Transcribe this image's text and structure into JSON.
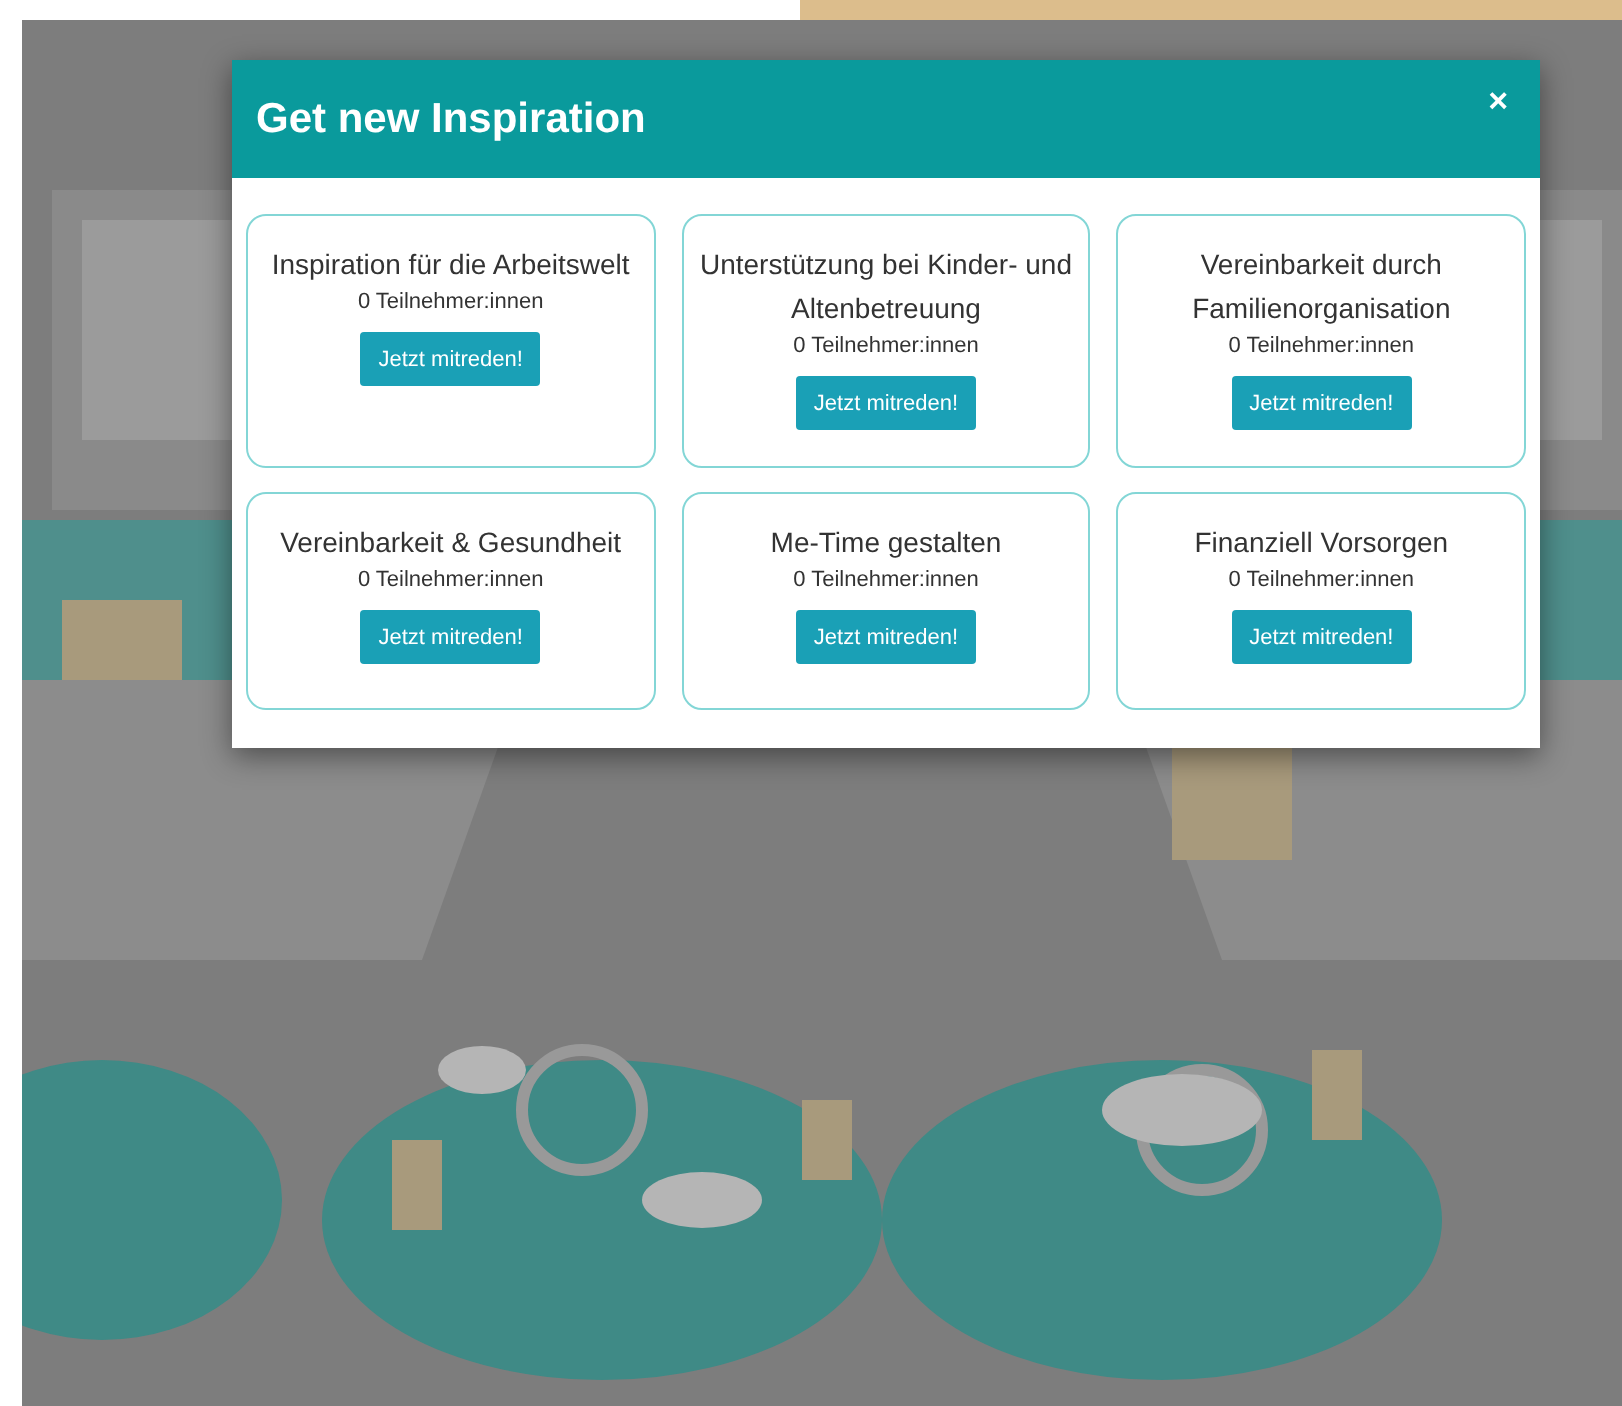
{
  "dialog": {
    "title": "Get new Inspiration",
    "close": "×",
    "topics": [
      {
        "title": "Inspiration für die Arbeitswelt",
        "participants": "0 Teilnehmer:innen",
        "button": "Jetzt mitreden!"
      },
      {
        "title": "Unterstützung bei Kinder- und Altenbetreuung",
        "participants": "0 Teilnehmer:innen",
        "button": "Jetzt mitreden!"
      },
      {
        "title": "Vereinbarkeit durch Familienorganisation",
        "participants": "0 Teilnehmer:innen",
        "button": "Jetzt mitreden!"
      },
      {
        "title": "Vereinbarkeit & Gesundheit",
        "participants": "0 Teilnehmer:innen",
        "button": "Jetzt mitreden!"
      },
      {
        "title": "Me-Time gestalten",
        "participants": "0 Teilnehmer:innen",
        "button": "Jetzt mitreden!"
      },
      {
        "title": "Finanziell Vorsorgen",
        "participants": "0 Teilnehmer:innen",
        "button": "Jetzt mitreden!"
      }
    ]
  }
}
